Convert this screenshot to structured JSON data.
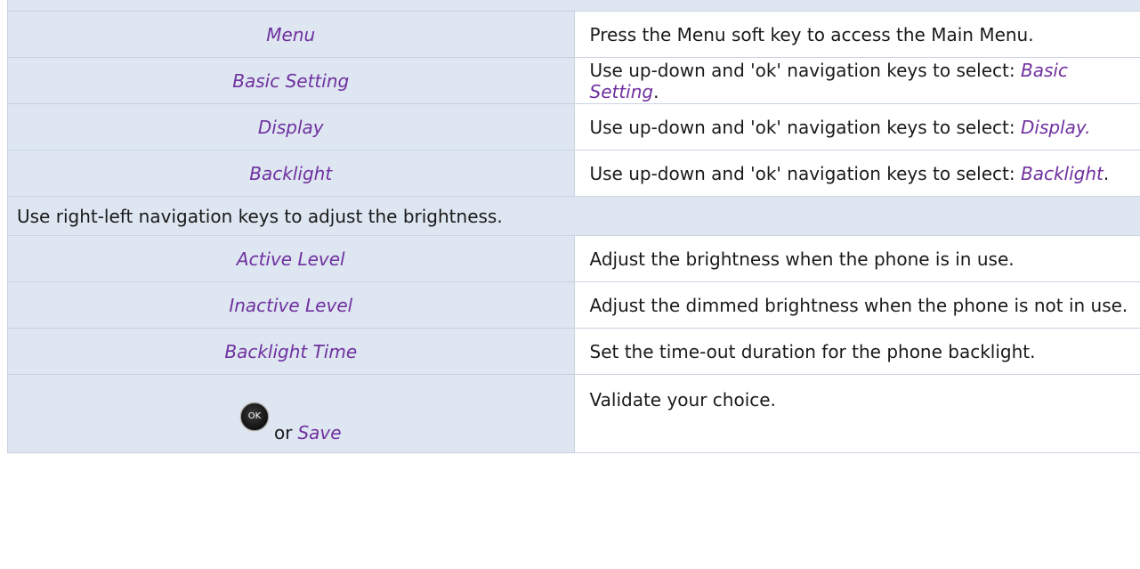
{
  "rows": [
    {
      "key": "Menu",
      "text": "Press the Menu soft key to access the Main Menu."
    },
    {
      "key": "Basic Setting",
      "prefix": "Use up-down and 'ok' navigation keys to select: ",
      "em": "Basic Setting",
      "suffix": "."
    },
    {
      "key": "Display",
      "prefix": "Use up-down and 'ok' navigation keys to select: ",
      "em": "Display.",
      "suffix": ""
    },
    {
      "key": "Backlight",
      "prefix": "Use up-down and 'ok' navigation keys to select: ",
      "em": "Backlight",
      "suffix": "."
    }
  ],
  "section": "Use right-left navigation keys to adjust the brightness.",
  "level_rows": [
    {
      "key": "Active Level",
      "text": "Adjust the brightness when the phone is in use."
    },
    {
      "key": "Inactive Level",
      "text": "Adjust the dimmed brightness when the phone is not in use."
    },
    {
      "key": "Backlight Time",
      "text": "Set the time-out duration for the phone backlight."
    }
  ],
  "final_row": {
    "ok_key_label": "OK",
    "or_word": "or",
    "key": "Save",
    "text": "Validate your choice."
  }
}
